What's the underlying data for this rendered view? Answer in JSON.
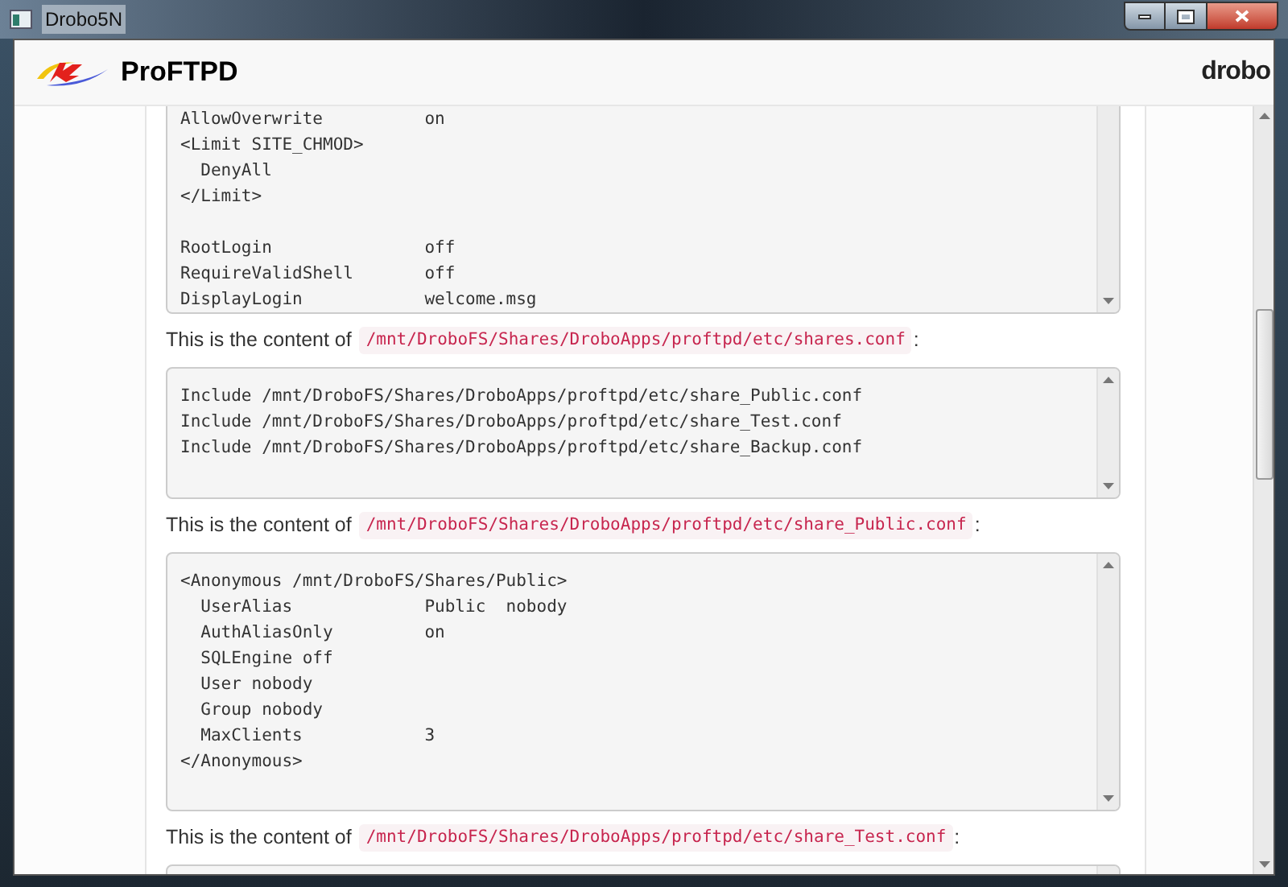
{
  "window": {
    "title": "Drobo5N"
  },
  "header": {
    "app_name": "ProFTPD",
    "brand": "drobo"
  },
  "content": [
    {
      "kind": "code",
      "groups": [
        [
          "AllowOverwrite          on",
          "<Limit SITE_CHMOD>",
          "  DenyAll",
          "</Limit>"
        ],
        [
          "RootLogin               off",
          "RequireValidShell       off",
          "DisplayLogin            welcome.msg"
        ]
      ]
    },
    {
      "kind": "paragraph",
      "text": "This is the content of",
      "path": "/mnt/DroboFS/Shares/DroboApps/proftpd/etc/shares.conf",
      "suffix": ":"
    },
    {
      "kind": "code",
      "lines": [
        "Include /mnt/DroboFS/Shares/DroboApps/proftpd/etc/share_Public.conf",
        "Include /mnt/DroboFS/Shares/DroboApps/proftpd/etc/share_Test.conf",
        "Include /mnt/DroboFS/Shares/DroboApps/proftpd/etc/share_Backup.conf"
      ]
    },
    {
      "kind": "paragraph",
      "text": "This is the content of",
      "path": "/mnt/DroboFS/Shares/DroboApps/proftpd/etc/share_Public.conf",
      "suffix": ":"
    },
    {
      "kind": "code",
      "lines": [
        "<Anonymous /mnt/DroboFS/Shares/Public>",
        "  UserAlias             Public  nobody",
        "  AuthAliasOnly         on",
        "  SQLEngine off",
        "  User nobody",
        "  Group nobody",
        "  MaxClients            3",
        "</Anonymous>"
      ]
    },
    {
      "kind": "paragraph",
      "text": "This is the content of",
      "path": "/mnt/DroboFS/Shares/DroboApps/proftpd/etc/share_Test.conf",
      "suffix": ":"
    },
    {
      "kind": "code"
    }
  ]
}
